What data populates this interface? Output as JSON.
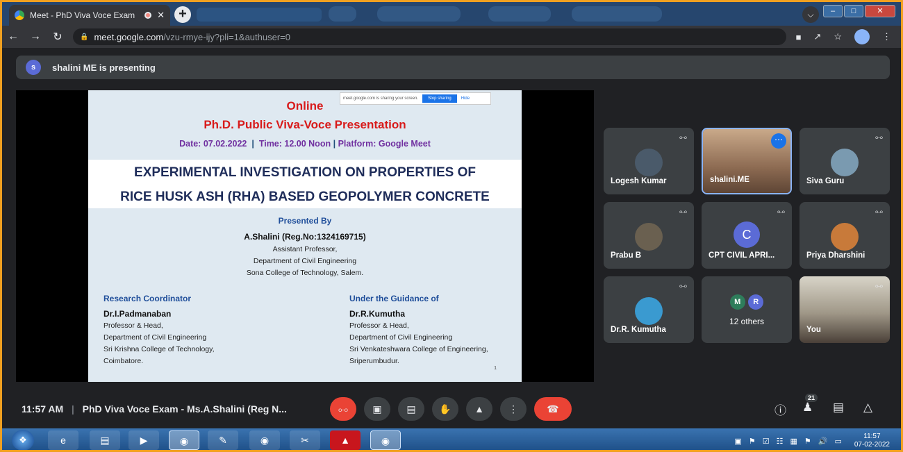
{
  "browser": {
    "tab_title": "Meet - PhD Viva Voce Exam",
    "tab_close": "✕",
    "new_tab": "+",
    "url_host": "meet.google.com",
    "url_path": "/vzu-rmye-ijy?pli=1&authuser=0"
  },
  "banner": {
    "avatar_letter": "s",
    "text": "shalini ME is presenting"
  },
  "slide": {
    "share_notice": "meet.google.com is sharing your screen.",
    "stop_sharing": "Stop sharing",
    "hide": "Hide",
    "online": "Online",
    "subtitle": "Ph.D. Public Viva-Voce Presentation",
    "date": "Date: 07.02.2022",
    "time": "Time: 12.00 Noon",
    "platform": "Platform: Google Meet",
    "title_line1": "EXPERIMENTAL INVESTIGATION ON PROPERTIES OF",
    "title_line2": "RICE HUSK ASH (RHA) BASED GEOPOLYMER CONCRETE",
    "presented_by": "Presented By",
    "presenter": "A.Shalini (Reg.No:1324169715)",
    "presenter_role": "Assistant Professor,",
    "presenter_dept": "Department of Civil Engineering",
    "presenter_college": "Sona College of Technology, Salem.",
    "left": {
      "heading": "Research Coordinator",
      "name": "Dr.I.Padmanaban",
      "line1": "Professor & Head,",
      "line2": "Department of Civil Engineering",
      "line3": "Sri Krishna College of Technology,",
      "line4": "Coimbatore."
    },
    "right": {
      "heading": "Under the Guidance of",
      "name": "Dr.R.Kumutha",
      "line1": "Professor & Head,",
      "line2": "Department of Civil Engineering",
      "line3": "Sri Venkateshwara College of Engineering,",
      "line4": "Sriperumbudur."
    },
    "page_number": "1"
  },
  "participants": [
    {
      "name": "Logesh Kumar"
    },
    {
      "name": "shalini.ME"
    },
    {
      "name": "Siva Guru"
    },
    {
      "name": "Prabu B"
    },
    {
      "name": "CPT CIVIL APRI...",
      "letter": "C"
    },
    {
      "name": "Priya Dharshini"
    },
    {
      "name": "Dr.R. Kumutha"
    },
    {
      "name": "12 others",
      "letters": [
        "M",
        "R"
      ]
    },
    {
      "name": "You"
    }
  ],
  "meetbar": {
    "time": "11:57 AM",
    "separator": "|",
    "meeting_title": "PhD Viva Voce Exam - Ms.A.Shalini (Reg N...",
    "people_count": "21"
  },
  "taskbar": {
    "time": "11:57",
    "date": "07-02-2022"
  }
}
